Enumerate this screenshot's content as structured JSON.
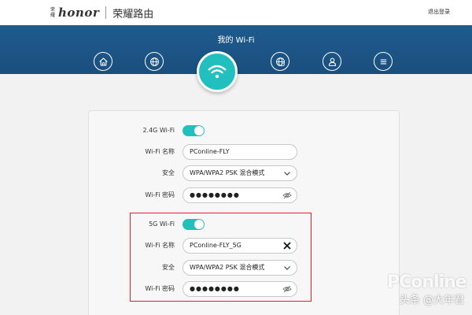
{
  "header": {
    "logo_mark": "荣耀",
    "logo_word": "honor",
    "product_name": "荣耀路由",
    "logout_label": "退出登录"
  },
  "banner": {
    "title": "我的 Wi-Fi",
    "nav_icons": [
      "home-icon",
      "globe-icon",
      "wifi-icon",
      "globe-settings-icon",
      "user-icon",
      "menu-icon"
    ]
  },
  "wifi24": {
    "toggle_label": "2.4G Wi-Fi",
    "toggle_on": true,
    "name_label": "Wi-Fi 名称",
    "name_value": "PConline-FLY",
    "security_label": "安全",
    "security_value": "WPA/WPA2 PSK 混合模式",
    "password_label": "Wi-Fi 密码",
    "password_value": "●●●●●●●●"
  },
  "wifi5": {
    "toggle_label": "5G Wi-Fi",
    "toggle_on": true,
    "name_label": "Wi-Fi 名称",
    "name_value": "PConline-FLY_5G",
    "security_label": "安全",
    "security_value": "WPA/WPA2 PSK 混合模式",
    "password_label": "Wi-Fi 密码",
    "password_value": "●●●●●●●●"
  },
  "watermark": {
    "site": "PConline",
    "author": "头条 @大年君"
  },
  "colors": {
    "banner": "#1f5b8e",
    "accent": "#21c0bf",
    "highlight": "#d9232d"
  }
}
